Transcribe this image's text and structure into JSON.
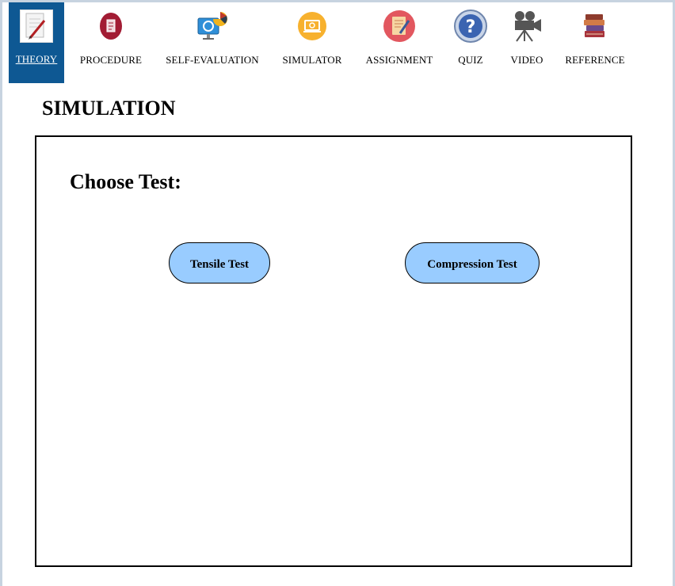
{
  "nav": {
    "items": [
      {
        "label": "THEORY",
        "icon": "theory-icon"
      },
      {
        "label": "PROCEDURE",
        "icon": "procedure-icon"
      },
      {
        "label": "SELF-EVALUATION",
        "icon": "self-evaluation-icon"
      },
      {
        "label": "SIMULATOR",
        "icon": "simulator-icon"
      },
      {
        "label": "ASSIGNMENT",
        "icon": "assignment-icon"
      },
      {
        "label": "QUIZ",
        "icon": "quiz-icon"
      },
      {
        "label": "VIDEO",
        "icon": "video-camera-icon"
      },
      {
        "label": "REFERENCE",
        "icon": "books-icon"
      }
    ],
    "active_index": 0
  },
  "page": {
    "title": "SIMULATION"
  },
  "simulation": {
    "heading": "Choose Test:",
    "tensile_label": "Tensile Test",
    "compression_label": "Compression Test"
  },
  "colors": {
    "nav_active_bg": "#0e5893",
    "button_bg": "#99ccff"
  }
}
